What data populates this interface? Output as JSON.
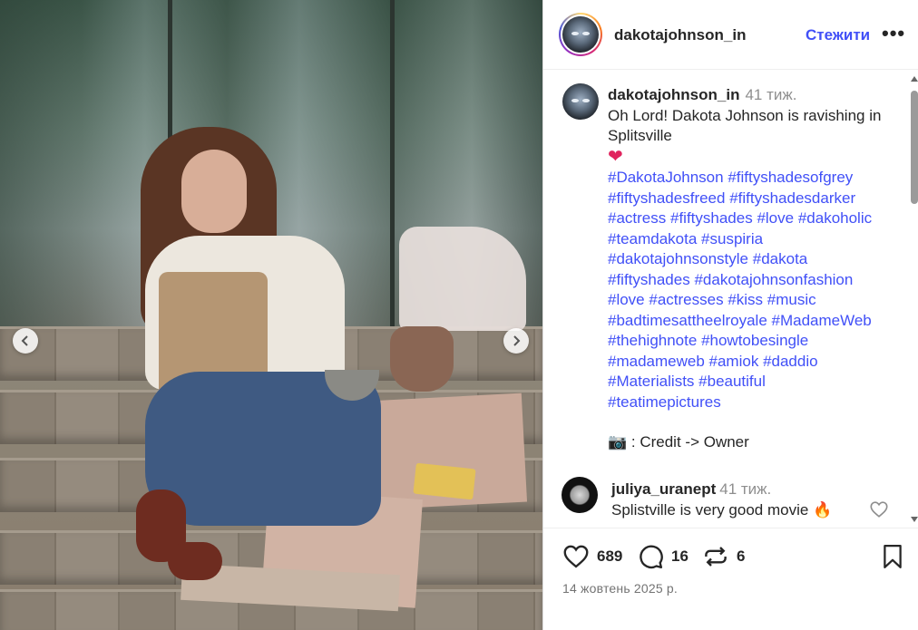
{
  "post": {
    "username": "dakotajohnson_in",
    "follow_label": "Стежити",
    "more_label": "•••"
  },
  "caption": {
    "username": "dakotajohnson_in",
    "time": "41 тиж.",
    "text": "Oh Lord! Dakota Johnson is ravishing in Splitsville",
    "emoji": "❤",
    "hashtags": [
      "#DakotaJohnson",
      "#fiftyshadesofgrey",
      "#fiftyshadesfreed",
      "#fiftyshadesdarker",
      "#actress",
      "#fiftyshades",
      "#love",
      "#dakoholic",
      "#teamdakota",
      "#suspiria",
      "#dakotajohnsonstyle",
      "#dakota",
      "#fiftyshades",
      "#dakotajohnsonfashion",
      "#love",
      "#actresses",
      "#kiss",
      "#music",
      "#badtimesattheelroyale",
      "#MadameWeb",
      "#thehighnote",
      "#howtobesingle",
      "#madameweb",
      "#amiok",
      "#daddio",
      "#Materialists",
      "#beautiful",
      "#teatimepictures"
    ],
    "credit": "📷 : Credit -> Owner"
  },
  "comment": {
    "username": "juliya_uranept",
    "time": "41 тиж.",
    "text": "Splistville is very good movie 🔥"
  },
  "actions": {
    "likes": "689",
    "comments": "16",
    "reposts": "6"
  },
  "date": "14 жовтень 2025 р.",
  "colors": {
    "link_blue": "#4150f7",
    "muted_gray": "#8e8e8e",
    "heart_red": "#e0245e"
  }
}
